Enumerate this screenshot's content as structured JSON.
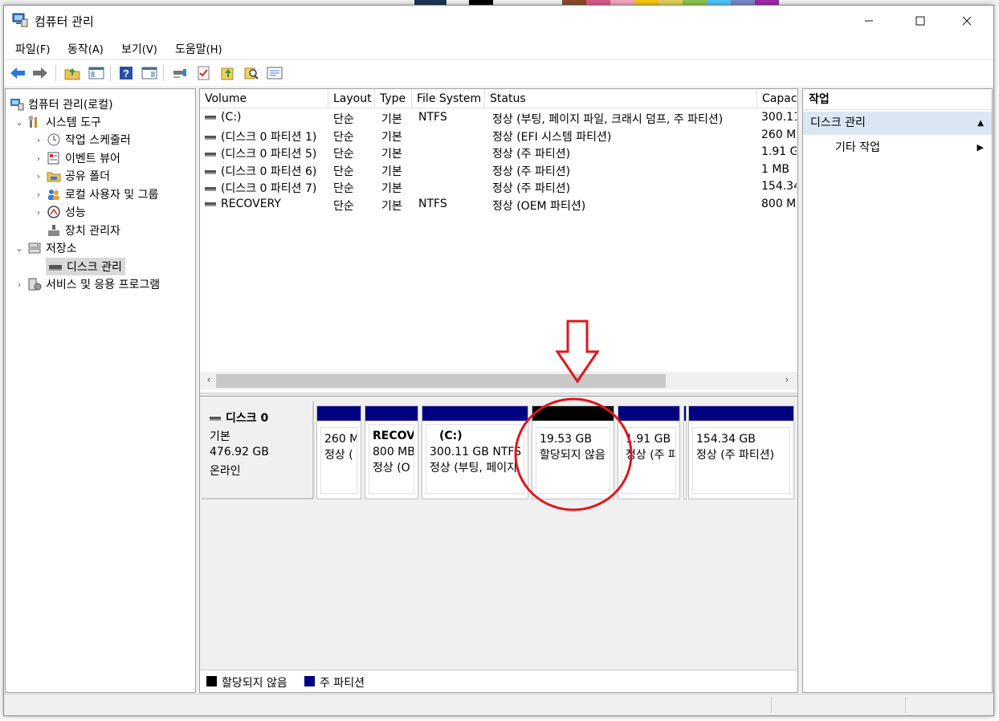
{
  "window": {
    "title": "컴퓨터 관리",
    "controls": {
      "minimize": "—",
      "maximize": "☐",
      "close": "✕"
    }
  },
  "menu": {
    "file": "파일",
    "file_key": "(F)",
    "action": "동작",
    "action_key": "(A)",
    "view": "보기",
    "view_key": "(V)",
    "help": "도움말",
    "help_key": "(H)"
  },
  "toolbar": [
    "back-icon",
    "forward-icon",
    "up-folder-icon",
    "show-hide-tree-icon",
    "help-icon",
    "show-action-pane-icon",
    "connect-icon",
    "check-icon",
    "folder-up-icon",
    "search-folder-icon",
    "properties-icon"
  ],
  "tree": {
    "root": "컴퓨터 관리(로컬)",
    "system_tools": "시스템 도구",
    "task_scheduler": "작업 스케줄러",
    "event_viewer": "이벤트 뷰어",
    "shared_folders": "공유 폴더",
    "local_users": "로컬 사용자 및 그룹",
    "performance": "성능",
    "device_manager": "장치 관리자",
    "storage": "저장소",
    "disk_management": "디스크 관리",
    "services": "서비스 및 응용 프로그램"
  },
  "volume_table": {
    "headers": [
      "Volume",
      "Layout",
      "Type",
      "File System",
      "Status",
      "Capaci"
    ],
    "rows": [
      [
        "(C:)",
        "단순",
        "기본",
        "NTFS",
        "정상 (부팅, 페이지 파일, 크래시 덤프, 주 파티션)",
        "300.11"
      ],
      [
        "(디스크 0 파티션 1)",
        "단순",
        "기본",
        "",
        "정상 (EFI 시스템 파티션)",
        "260 M"
      ],
      [
        "(디스크 0 파티션 5)",
        "단순",
        "기본",
        "",
        "정상 (주 파티션)",
        "1.91 G"
      ],
      [
        "(디스크 0 파티션 6)",
        "단순",
        "기본",
        "",
        "정상 (주 파티션)",
        "1 MB"
      ],
      [
        "(디스크 0 파티션 7)",
        "단순",
        "기본",
        "",
        "정상 (주 파티션)",
        "154.34"
      ],
      [
        "RECOVERY",
        "단순",
        "기본",
        "NTFS",
        "정상 (OEM 파티션)",
        "800 M"
      ]
    ]
  },
  "disk": {
    "name": "디스크 0",
    "type": "기본",
    "size": "476.92 GB",
    "state": "온라인",
    "partitions": [
      {
        "title": "",
        "line1": "260 M",
        "line2": "정상 (",
        "kind": "primary"
      },
      {
        "title": "RECOVI",
        "line1": "800 MB",
        "line2": "정상 (O",
        "kind": "primary"
      },
      {
        "title": "(C:)",
        "line1": "300.11 GB NTFS",
        "line2": "정상 (부팅, 페이지",
        "kind": "primary"
      },
      {
        "title": "",
        "line1": "19.53 GB",
        "line2": "할당되지 않음",
        "kind": "unallocated"
      },
      {
        "title": "",
        "line1": "1.91 GB",
        "line2": "정상 (주 파",
        "kind": "primary"
      },
      {
        "title": "",
        "line1": "154.34 GB",
        "line2": "정상 (주 파티션)",
        "kind": "primary"
      }
    ]
  },
  "legend": {
    "unallocated": "할당되지 않음",
    "primary": "주 파티션",
    "unallocated_color": "#000000",
    "primary_color": "#000080"
  },
  "actions": {
    "title": "작업",
    "section": "디스크 관리",
    "more": "기타 작업"
  },
  "annotation": {
    "color": "#e0161b",
    "shape": "down-arrow-and-circle"
  }
}
